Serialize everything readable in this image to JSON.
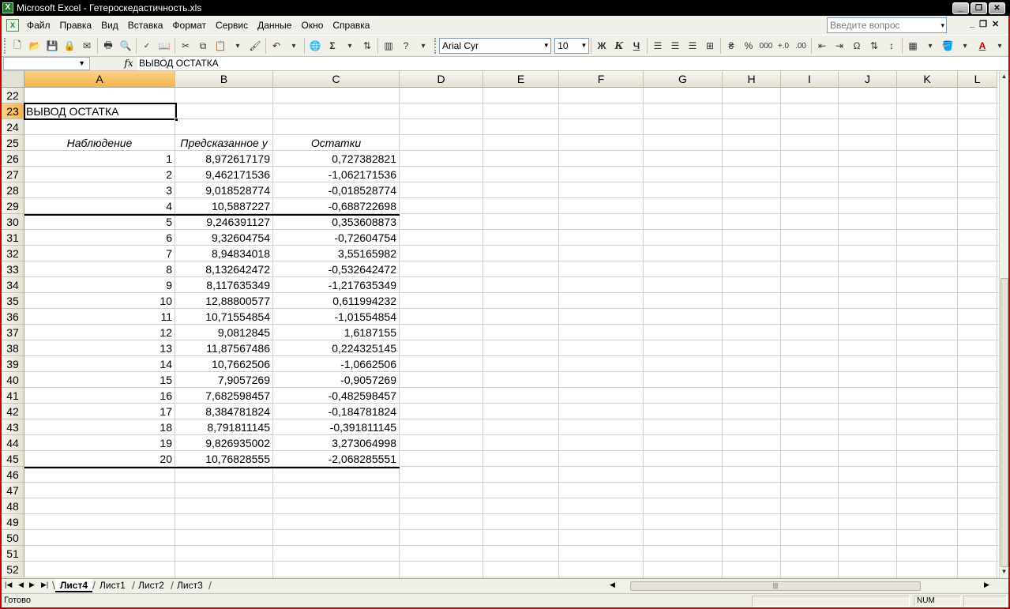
{
  "window": {
    "title": "Microsoft Excel - Гетероскедастичность.xls",
    "icon": "excel-app-icon",
    "buttons": [
      "minimize",
      "restore",
      "close"
    ]
  },
  "menubar": {
    "items": [
      {
        "label": "Файл"
      },
      {
        "label": "Правка"
      },
      {
        "label": "Вид"
      },
      {
        "label": "Вставка"
      },
      {
        "label": "Формат"
      },
      {
        "label": "Сервис"
      },
      {
        "label": "Данные"
      },
      {
        "label": "Окно"
      },
      {
        "label": "Справка"
      }
    ],
    "help_placeholder": "Введите вопрос"
  },
  "toolbar": {
    "font_name": "Arial Cyr",
    "font_size": "10",
    "bold_label": "Ж",
    "italic_label": "К",
    "underline_label": "Ч",
    "sum_label": "Σ",
    "percent_label": "%",
    "thousands_label": "000",
    "omega_label": "Ω"
  },
  "formula_bar": {
    "name_box": "",
    "fx_label": "fx",
    "content": "ВЫВОД ОСТАТКА"
  },
  "sheet": {
    "columns": [
      "A",
      "B",
      "C",
      "D",
      "E",
      "F",
      "G",
      "H",
      "I",
      "J",
      "K",
      "L"
    ],
    "selected_column": "A",
    "selected_row": "23",
    "rows": [
      {
        "num": "22",
        "a": "",
        "b": "",
        "c": ""
      },
      {
        "num": "23",
        "a": "ВЫВОД ОСТАТКА",
        "b": "",
        "c": ""
      },
      {
        "num": "24",
        "a": "",
        "b": "",
        "c": ""
      },
      {
        "num": "25",
        "a": "Наблюдение",
        "b": "Предсказанное y",
        "c": "Остатки"
      },
      {
        "num": "26",
        "a": "1",
        "b": "8,972617179",
        "c": "0,727382821"
      },
      {
        "num": "27",
        "a": "2",
        "b": "9,462171536",
        "c": "-1,062171536"
      },
      {
        "num": "28",
        "a": "3",
        "b": "9,018528774",
        "c": "-0,018528774"
      },
      {
        "num": "29",
        "a": "4",
        "b": "10,5887227",
        "c": "-0,688722698"
      },
      {
        "num": "30",
        "a": "5",
        "b": "9,246391127",
        "c": "0,353608873"
      },
      {
        "num": "31",
        "a": "6",
        "b": "9,32604754",
        "c": "-0,72604754"
      },
      {
        "num": "32",
        "a": "7",
        "b": "8,94834018",
        "c": "3,55165982"
      },
      {
        "num": "33",
        "a": "8",
        "b": "8,132642472",
        "c": "-0,532642472"
      },
      {
        "num": "34",
        "a": "9",
        "b": "8,117635349",
        "c": "-1,217635349"
      },
      {
        "num": "35",
        "a": "10",
        "b": "12,88800577",
        "c": "0,611994232"
      },
      {
        "num": "36",
        "a": "11",
        "b": "10,71554854",
        "c": "-1,01554854"
      },
      {
        "num": "37",
        "a": "12",
        "b": "9,0812845",
        "c": "1,6187155"
      },
      {
        "num": "38",
        "a": "13",
        "b": "11,87567486",
        "c": "0,224325145"
      },
      {
        "num": "39",
        "a": "14",
        "b": "10,7662506",
        "c": "-1,0662506"
      },
      {
        "num": "40",
        "a": "15",
        "b": "7,9057269",
        "c": "-0,9057269"
      },
      {
        "num": "41",
        "a": "16",
        "b": "7,682598457",
        "c": "-0,482598457"
      },
      {
        "num": "42",
        "a": "17",
        "b": "8,384781824",
        "c": "-0,184781824"
      },
      {
        "num": "43",
        "a": "18",
        "b": "8,791811145",
        "c": "-0,391811145"
      },
      {
        "num": "44",
        "a": "19",
        "b": "9,826935002",
        "c": "3,273064998"
      },
      {
        "num": "45",
        "a": "20",
        "b": "10,76828555",
        "c": "-2,068285551"
      },
      {
        "num": "46",
        "a": "",
        "b": "",
        "c": ""
      },
      {
        "num": "47",
        "a": "",
        "b": "",
        "c": ""
      },
      {
        "num": "48",
        "a": "",
        "b": "",
        "c": ""
      },
      {
        "num": "49",
        "a": "",
        "b": "",
        "c": ""
      },
      {
        "num": "50",
        "a": "",
        "b": "",
        "c": ""
      },
      {
        "num": "51",
        "a": "",
        "b": "",
        "c": ""
      },
      {
        "num": "52",
        "a": "",
        "b": "",
        "c": ""
      }
    ]
  },
  "tabs": {
    "items": [
      "Лист4",
      "Лист1",
      "Лист2",
      "Лист3"
    ],
    "active": "Лист4"
  },
  "status": {
    "ready": "Готово",
    "num": "NUM"
  },
  "colors": {
    "window_border": "#c00000",
    "titlebar": "#000000",
    "chrome": "#f0efe8",
    "header_selected": "#f4b24a",
    "gridline": "#d4d0c8"
  }
}
